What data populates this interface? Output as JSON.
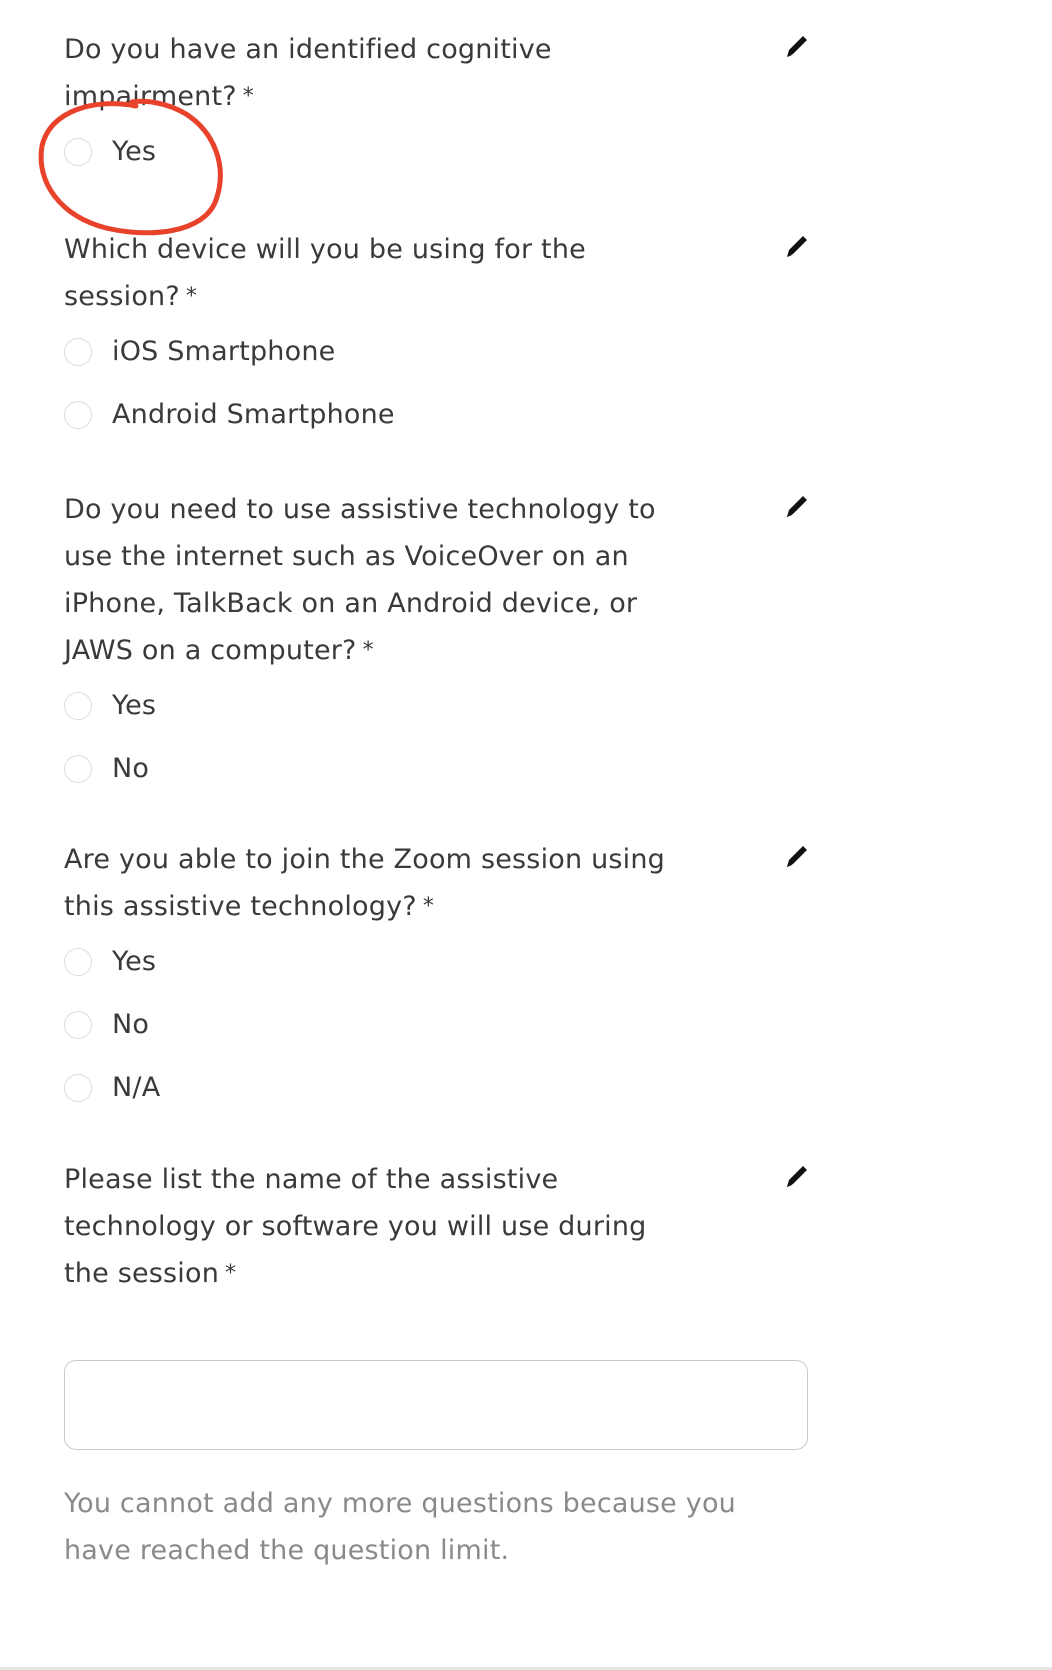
{
  "questions": [
    {
      "text": "Do you have an identified cognitive impairment?",
      "required_mark": "*",
      "options": [
        "Yes"
      ]
    },
    {
      "text": "Which device will you be using for the session?",
      "required_mark": "*",
      "options": [
        "iOS Smartphone",
        "Android Smartphone"
      ]
    },
    {
      "text": "Do you need to use assistive technology to use the internet such as VoiceOver on an iPhone, TalkBack on an Android device, or JAWS on a computer?",
      "required_mark": "*",
      "options": [
        "Yes",
        "No"
      ]
    },
    {
      "text": "Are you able to join the Zoom session using this assistive technology?",
      "required_mark": "*",
      "options": [
        "Yes",
        "No",
        "N/A"
      ]
    },
    {
      "text": "Please list the name of the assistive technology or software you will use during the session",
      "required_mark": "*",
      "input_value": ""
    }
  ],
  "limit_message": "You cannot add any more questions because you have reached the question limit.",
  "icons": {
    "edit": "pencil-icon",
    "annotation": "red-circle-annotation"
  },
  "colors": {
    "text": "#3a3a3a",
    "muted_text": "#8a8a8a",
    "annotation": "#e8422a",
    "radio_border": "#dcdcdc"
  }
}
